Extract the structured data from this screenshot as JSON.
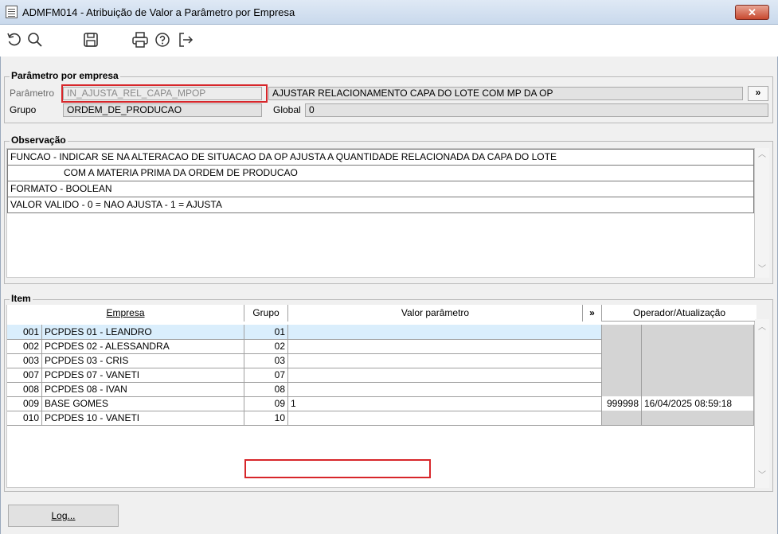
{
  "window": {
    "title": "ADMFM014 - Atribuição de Valor a Parâmetro por Empresa",
    "close_label": "✕"
  },
  "toolbar": {
    "icons": [
      "refresh-icon",
      "search-icon",
      "save-icon",
      "print-icon",
      "help-icon",
      "exit-icon"
    ]
  },
  "parametro_group": {
    "legend": "Parâmetro por empresa",
    "parametro_label": "Parâmetro",
    "parametro_value": "IN_AJUSTA_REL_CAPA_MPOP",
    "descricao": "AJUSTAR RELACIONAMENTO CAPA DO LOTE COM MP DA OP",
    "expand_label": "»",
    "grupo_label": "Grupo",
    "grupo_value": "ORDEM_DE_PRODUCAO",
    "global_label": "Global",
    "global_value": "0"
  },
  "observacao": {
    "legend": "Observação",
    "lines": [
      "FUNCAO - INDICAR SE NA ALTERACAO DE SITUACAO DA OP AJUSTA A QUANTIDADE RELACIONADA DA CAPA DO LOTE",
      "                    COM A MATERIA PRIMA DA ORDEM DE PRODUCAO",
      "FORMATO - BOOLEAN",
      "VALOR VALIDO - 0 = NAO AJUSTA - 1 = AJUSTA"
    ]
  },
  "item": {
    "legend": "Item",
    "headers": {
      "empresa": "Empresa",
      "grupo": "Grupo",
      "valor": "Valor parâmetro",
      "expand": "»",
      "operador": "Operador/Atualização"
    },
    "rows": [
      {
        "code": "001",
        "empresa": "PCPDES 01 - LEANDRO",
        "grupo": "01",
        "valor": "",
        "operador": "",
        "atualizacao": ""
      },
      {
        "code": "002",
        "empresa": "PCPDES 02 - ALESSANDRA",
        "grupo": "02",
        "valor": "",
        "operador": "",
        "atualizacao": ""
      },
      {
        "code": "003",
        "empresa": "PCPDES 03 - CRIS",
        "grupo": "03",
        "valor": "",
        "operador": "",
        "atualizacao": ""
      },
      {
        "code": "007",
        "empresa": "PCPDES 07 - VANETI",
        "grupo": "07",
        "valor": "",
        "operador": "",
        "atualizacao": ""
      },
      {
        "code": "008",
        "empresa": "PCPDES 08 - IVAN",
        "grupo": "08",
        "valor": "",
        "operador": "",
        "atualizacao": ""
      },
      {
        "code": "009",
        "empresa": "BASE GOMES",
        "grupo": "09",
        "valor": "1",
        "operador": "999998",
        "atualizacao": "16/04/2025 08:59:18"
      },
      {
        "code": "010",
        "empresa": "PCPDES 10 - VANETI",
        "grupo": "10",
        "valor": "",
        "operador": "",
        "atualizacao": ""
      }
    ]
  },
  "footer": {
    "log_label": "Log..."
  },
  "colors": {
    "highlight_box": "#d7262a",
    "selected_row": "#daeefc"
  }
}
